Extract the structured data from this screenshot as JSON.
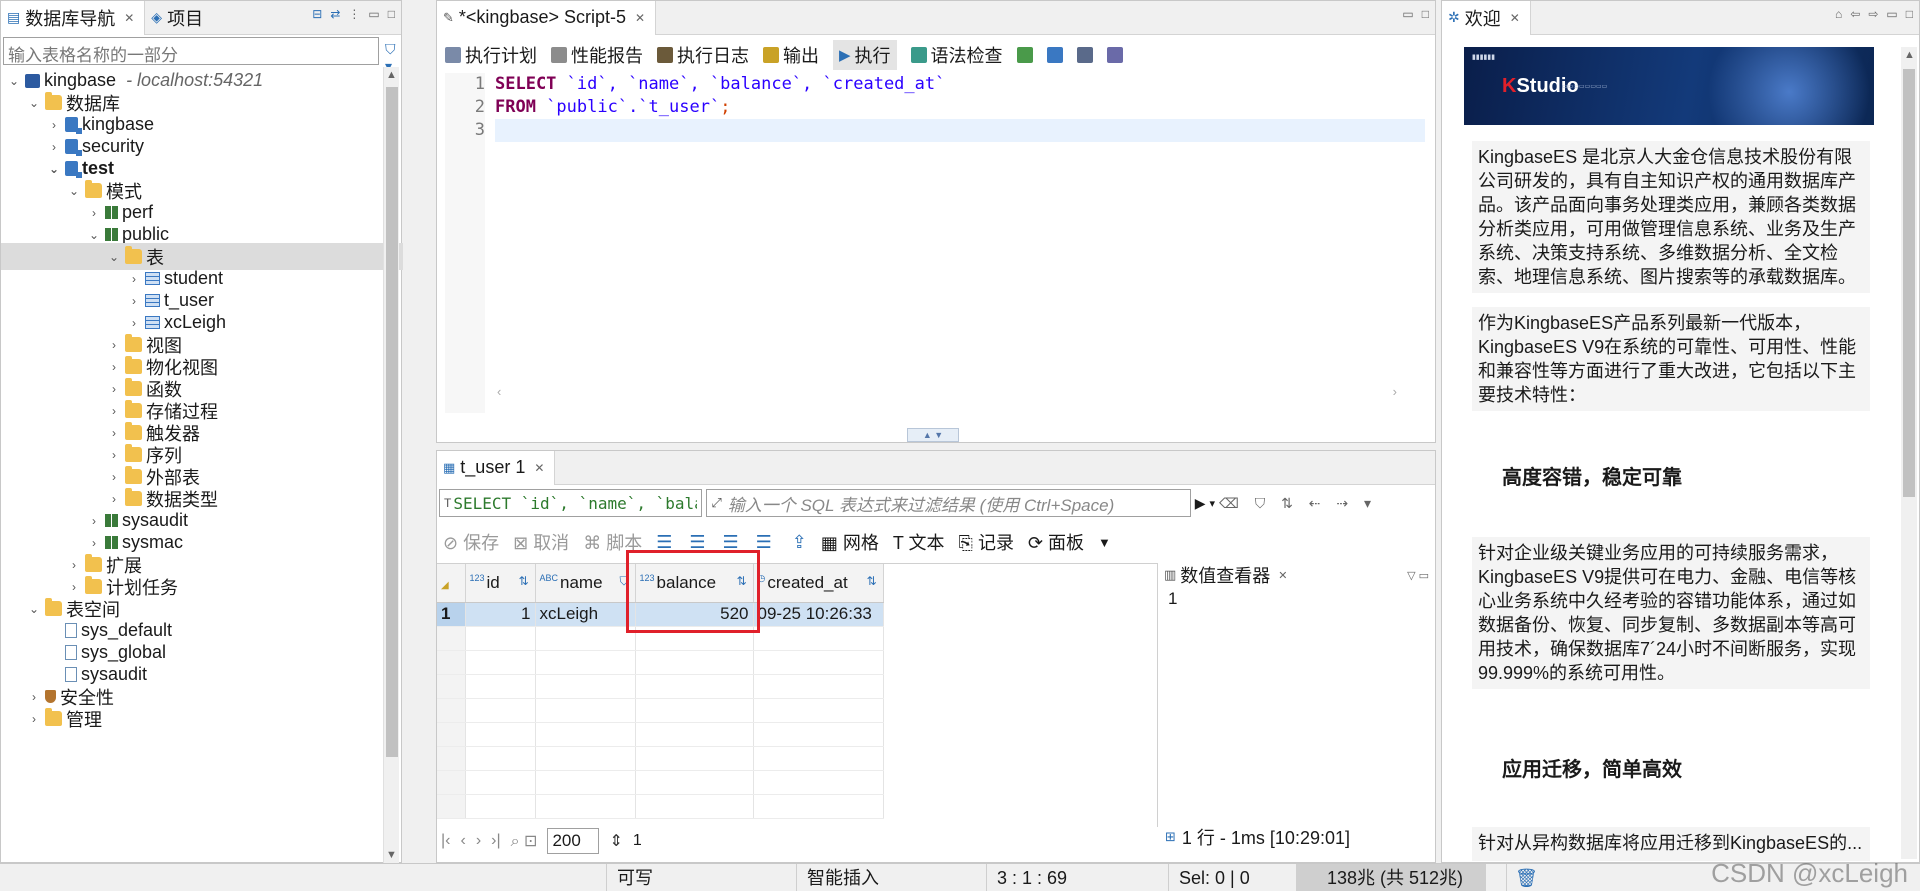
{
  "nav": {
    "tabs": [
      {
        "label": "数据库导航",
        "close": "✕"
      },
      {
        "label": "项目"
      }
    ],
    "filter_placeholder": "输入表格名称的一部分",
    "tree": [
      {
        "label": "kingbase",
        "sub": "- localhost:54321",
        "icon": "server",
        "level": 0,
        "twist": "⌄"
      },
      {
        "label": "数据库",
        "icon": "folder",
        "level": 1,
        "twist": "⌄"
      },
      {
        "label": "kingbase",
        "icon": "db",
        "level": 2,
        "twist": "›"
      },
      {
        "label": "security",
        "icon": "db",
        "level": 2,
        "twist": "›"
      },
      {
        "label": "test",
        "icon": "db",
        "level": 2,
        "twist": "⌄",
        "bold": true
      },
      {
        "label": "模式",
        "icon": "folder",
        "level": 3,
        "twist": "⌄"
      },
      {
        "label": "perf",
        "icon": "schema",
        "level": 4,
        "twist": "›"
      },
      {
        "label": "public",
        "icon": "schema",
        "level": 4,
        "twist": "⌄"
      },
      {
        "label": "表",
        "icon": "folder",
        "level": 5,
        "twist": "⌄",
        "selected": true
      },
      {
        "label": "student",
        "icon": "table",
        "level": 6,
        "twist": "›"
      },
      {
        "label": "t_user",
        "icon": "table",
        "level": 6,
        "twist": "›"
      },
      {
        "label": "xcLeigh",
        "icon": "table",
        "level": 6,
        "twist": "›"
      },
      {
        "label": "视图",
        "icon": "folder",
        "level": 5,
        "twist": "›"
      },
      {
        "label": "物化视图",
        "icon": "folder",
        "level": 5,
        "twist": "›"
      },
      {
        "label": "函数",
        "icon": "folder",
        "level": 5,
        "twist": "›"
      },
      {
        "label": "存储过程",
        "icon": "folder",
        "level": 5,
        "twist": "›"
      },
      {
        "label": "触发器",
        "icon": "folder",
        "level": 5,
        "twist": "›"
      },
      {
        "label": "序列",
        "icon": "folder",
        "level": 5,
        "twist": "›"
      },
      {
        "label": "外部表",
        "icon": "folder",
        "level": 5,
        "twist": "›"
      },
      {
        "label": "数据类型",
        "icon": "folder",
        "level": 5,
        "twist": "›"
      },
      {
        "label": "sysaudit",
        "icon": "schema",
        "level": 4,
        "twist": "›"
      },
      {
        "label": "sysmac",
        "icon": "schema",
        "level": 4,
        "twist": "›"
      },
      {
        "label": "扩展",
        "icon": "folder",
        "level": 3,
        "twist": "›"
      },
      {
        "label": "计划任务",
        "icon": "folder",
        "level": 3,
        "twist": "›"
      },
      {
        "label": "表空间",
        "icon": "folder",
        "level": 1,
        "twist": "⌄"
      },
      {
        "label": "sys_default",
        "icon": "file",
        "level": 2,
        "twist": ""
      },
      {
        "label": "sys_global",
        "icon": "file",
        "level": 2,
        "twist": ""
      },
      {
        "label": "sysaudit",
        "icon": "file",
        "level": 2,
        "twist": ""
      },
      {
        "label": "安全性",
        "icon": "shield",
        "level": 1,
        "twist": "›"
      },
      {
        "label": "管理",
        "icon": "folder",
        "level": 1,
        "twist": "›"
      }
    ]
  },
  "editor": {
    "tab": "*<kingbase> Script-5",
    "toolbar": [
      "执行计划",
      "性能报告",
      "执行日志",
      "输出",
      "执行",
      "语法检查"
    ],
    "line_numbers": [
      "1",
      "2",
      "3"
    ],
    "code": {
      "l1_kw": "SELECT",
      "l1_rest": " `id`, `name`, `balance`, `created_at`",
      "l2_kw": "FROM",
      "l2_rest": " `public`.`t_user`",
      "l2_semi": ";"
    }
  },
  "results": {
    "tab": "t_user 1",
    "filter_sql": "SELECT `id`, `name`, `balance",
    "filter_placeholder": "输入一个 SQL 表达式来过滤结果 (使用 Ctrl+Space)",
    "toolbar": {
      "save": "保存",
      "cancel": "取消",
      "script": "脚本",
      "grid": "网格",
      "text": "文本",
      "record": "记录",
      "panel": "面板"
    },
    "columns": [
      {
        "type": "123",
        "name": "id"
      },
      {
        "type": "ABC",
        "name": "name"
      },
      {
        "type": "123",
        "name": "balance"
      },
      {
        "type": "",
        "name": "created_at"
      }
    ],
    "rows": [
      {
        "n": "1",
        "id": "1",
        "name": "xcLeigh",
        "balance": "520",
        "created_at": "09-25 10:26:33"
      }
    ],
    "value_viewer_title": "数值查看器",
    "value_viewer_value": "1",
    "page_size": "200",
    "fetched": "1",
    "stat": "1 行 - 1ms [10:29:01]"
  },
  "welcome": {
    "tab": "欢迎",
    "banner_logo_letter": "K",
    "banner_logo_text": "Studio",
    "para1": "KingbaseES 是北京人大金仓信息技术股份有限公司研发的，具有自主知识产权的通用数据库产品。该产品面向事务处理类应用，兼顾各类数据分析类应用，可用做管理信息系统、业务及生产系统、决策支持系统、多维数据分析、全文检索、地理信息系统、图片搜索等的承载数据库。",
    "para2": "作为KingbaseES产品系列最新一代版本，KingbaseES V9在系统的可靠性、可用性、性能和兼容性等方面进行了重大改进，它包括以下主要技术特性：",
    "head1": "高度容错，稳定可靠",
    "para3": "针对企业级关键业务应用的可持续服务需求，KingbaseES V9提供可在电力、金融、电信等核心业务系统中久经考验的容错功能体系，通过如数据备份、恢复、同步复制、多数据副本等高可用技术，确保数据库7´24小时不间断服务，实现99.999%的系统可用性。",
    "head2": "应用迁移，简单高效",
    "para4": "针对从异构数据库将应用迁移到KingbaseES的..."
  },
  "status": {
    "writable": "可写",
    "insert_mode": "智能插入",
    "position": "3 : 1 : 69",
    "selection": "Sel: 0 | 0",
    "heap": "138兆 (共 512兆)",
    "watermark": "CSDN @xcLeigh"
  },
  "colors": {
    "highlight_box": "#e0202a",
    "selected_row": "#cfe1f3",
    "keyword": "#7f0055"
  }
}
